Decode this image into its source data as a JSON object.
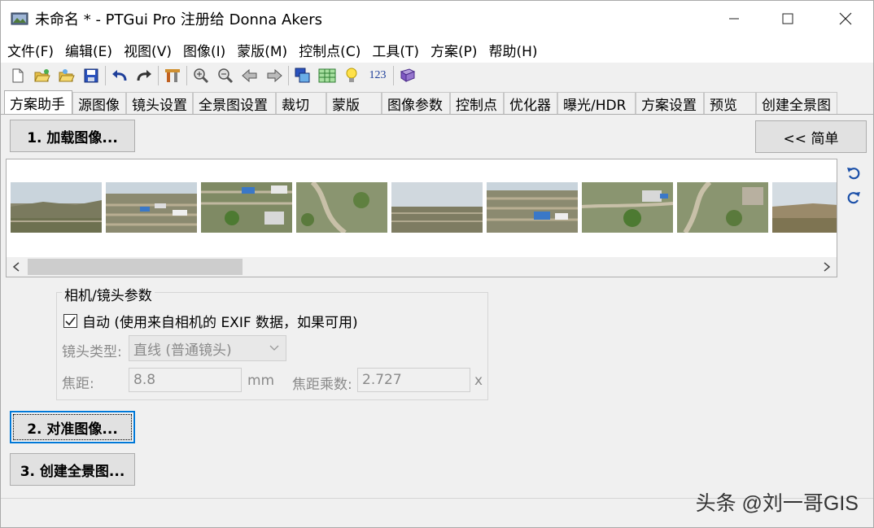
{
  "window": {
    "title": "未命名 * - PTGui Pro 注册给 Donna Akers",
    "controls": {
      "minimize": "—",
      "maximize": "☐",
      "close": "✕"
    }
  },
  "menu": {
    "items": [
      "文件(F)",
      "编辑(E)",
      "视图(V)",
      "图像(I)",
      "蒙版(M)",
      "控制点(C)",
      "工具(T)",
      "方案(P)",
      "帮助(H)"
    ]
  },
  "toolbar": {
    "icons": [
      "new-file-icon",
      "open-folder-icon",
      "open-recent-icon",
      "save-icon",
      "undo-icon",
      "redo-icon",
      "tools-icon",
      "zoom-in-icon",
      "zoom-out-icon",
      "back-icon",
      "forward-icon",
      "panorama-editor-icon",
      "table-icon",
      "lightbulb-icon",
      "numbering-icon",
      "book-icon"
    ],
    "numbering_label": "123"
  },
  "tabs": [
    "方案助手",
    "源图像",
    "镜头设置",
    "全景图设置",
    "裁切",
    "蒙版",
    "图像参数",
    "控制点",
    "优化器",
    "曝光/HDR",
    "方案设置",
    "预览",
    "创建全景图"
  ],
  "active_tab": "方案助手",
  "assistant": {
    "load_button": "1. 加载图像...",
    "simple_button": "<< 简单",
    "align_button": "2. 对准图像...",
    "create_button": "3. 创建全景图..."
  },
  "camera_group": {
    "title": "相机/镜头参数",
    "auto_checkbox": {
      "label": "自动 (使用来自相机的 EXIF 数据，如果可用)",
      "checked": true
    },
    "lens_type_label": "镜头类型:",
    "lens_type_value": "直线 (普通镜头)",
    "focal_label": "焦距:",
    "focal_value": "8.8",
    "focal_unit": "mm",
    "crop_label": "焦距乘数:",
    "crop_value": "2.727",
    "crop_unit": "x"
  },
  "thumbnails": {
    "count": 9
  },
  "watermark": "头条 @刘一哥GIS",
  "colors": {
    "accent": "#0078d7",
    "rotate_icon": "#1a4fa8"
  }
}
